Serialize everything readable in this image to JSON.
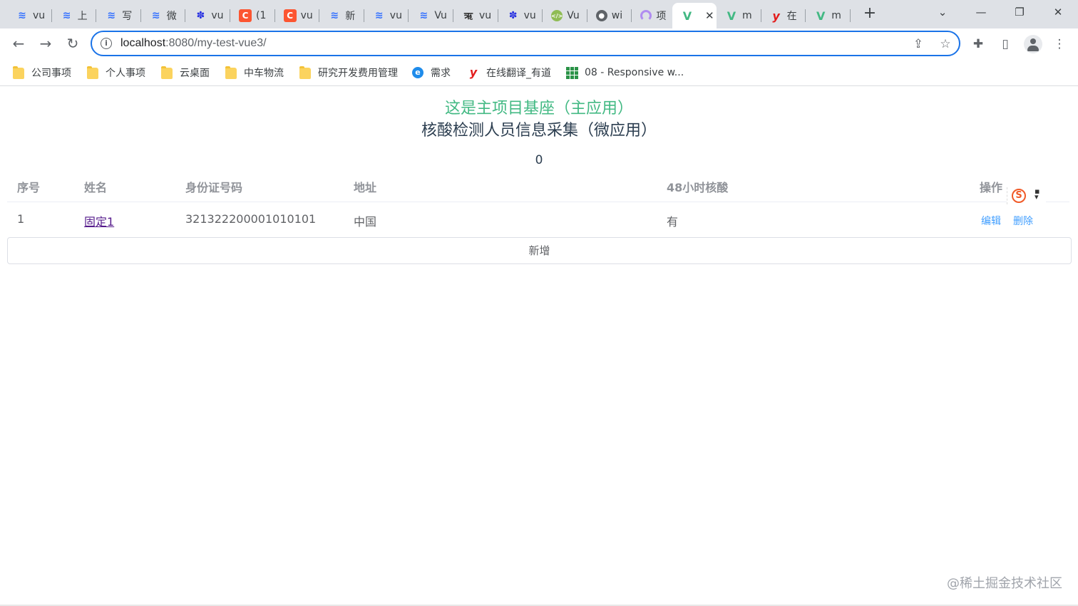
{
  "browser": {
    "tabs": [
      {
        "icon": "lark-icon",
        "glyph": "≋",
        "kind": "lark",
        "title": "vu"
      },
      {
        "icon": "lark-icon",
        "glyph": "≋",
        "kind": "lark",
        "title": "上"
      },
      {
        "icon": "lark-icon",
        "glyph": "≋",
        "kind": "lark",
        "title": "写"
      },
      {
        "icon": "lark-icon",
        "glyph": "≋",
        "kind": "lark",
        "title": "微"
      },
      {
        "icon": "baidu-icon",
        "glyph": "✽",
        "kind": "baidu",
        "title": "vu"
      },
      {
        "icon": "csdn-icon",
        "glyph": "C",
        "kind": "csdn",
        "title": "(1"
      },
      {
        "icon": "csdn-icon",
        "glyph": "C",
        "kind": "csdn",
        "title": "vu"
      },
      {
        "icon": "lark-icon",
        "glyph": "≋",
        "kind": "lark",
        "title": "新"
      },
      {
        "icon": "lark-icon",
        "glyph": "≋",
        "kind": "lark",
        "title": "vu"
      },
      {
        "icon": "lark-icon",
        "glyph": "≋",
        "kind": "lark",
        "title": "Vu"
      },
      {
        "icon": "rupee-icon",
        "glyph": "ऋ",
        "kind": "rupee",
        "title": "vu"
      },
      {
        "icon": "baidu-icon",
        "glyph": "✽",
        "kind": "baidu",
        "title": "vu"
      },
      {
        "icon": "green-circle-icon",
        "glyph": "</>",
        "kind": "green",
        "title": "Vu"
      },
      {
        "icon": "globe-icon",
        "glyph": "●",
        "kind": "globe",
        "title": "wi"
      },
      {
        "icon": "rainbow-icon",
        "glyph": "",
        "kind": "rainbow",
        "title": "项"
      },
      {
        "icon": "vue-icon",
        "glyph": "V",
        "kind": "vue",
        "title": "",
        "active": true
      },
      {
        "icon": "vue-icon",
        "glyph": "V",
        "kind": "vue",
        "title": "m"
      },
      {
        "icon": "youdao-icon",
        "glyph": "y",
        "kind": "youdao",
        "title": "在"
      },
      {
        "icon": "vue-icon",
        "glyph": "V",
        "kind": "vue",
        "title": "m"
      }
    ],
    "active_tab_close": "✕",
    "new_tab": "+",
    "url_host": "localhost",
    "url_path": ":8080/my-test-vue3/",
    "bookmarks": [
      {
        "type": "folder",
        "label": "公司事项"
      },
      {
        "type": "folder",
        "label": "个人事项"
      },
      {
        "type": "folder",
        "label": "云桌面"
      },
      {
        "type": "folder",
        "label": "中车物流"
      },
      {
        "type": "folder",
        "label": "研究开发费用管理"
      },
      {
        "type": "need",
        "label": "需求"
      },
      {
        "type": "youdao",
        "label": "在线翻译_有道"
      },
      {
        "type": "grid",
        "label": "08 - Responsive w..."
      }
    ]
  },
  "app": {
    "main_title": "这是主项目基座（主应用）",
    "sub_title": "核酸检测人员信息采集（微应用）",
    "counter": "0",
    "table": {
      "headers": [
        "序号",
        "姓名",
        "身份证号码",
        "地址",
        "48小时核酸",
        "操作"
      ],
      "rows": [
        {
          "index": "1",
          "name": "固定1",
          "id_number": "321322200001010101",
          "address": "中国",
          "test_48h": "有",
          "edit": "编辑",
          "delete": "删除"
        }
      ]
    },
    "add_button": "新增"
  },
  "watermark": "@稀土掘金技术社区",
  "colors": {
    "accent_green": "#42b983",
    "link_blue": "#409eff",
    "omnibox_border": "#1a73e8"
  }
}
